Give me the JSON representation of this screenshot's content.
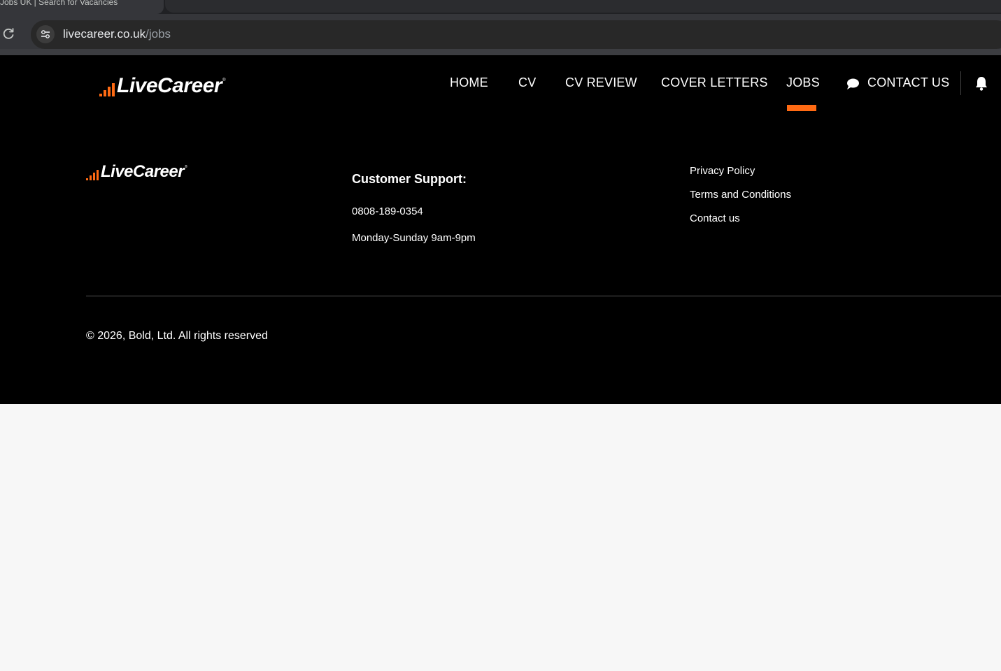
{
  "browser": {
    "tab_title": "Jobs UK | Search for Vacancies",
    "url_host": "livecareer.co.uk",
    "url_path": "/jobs"
  },
  "header": {
    "logo_text": "LiveCareer",
    "nav": [
      {
        "label": "HOME",
        "active": false
      },
      {
        "label": "CV",
        "active": false
      },
      {
        "label": "CV REVIEW",
        "active": false
      },
      {
        "label": "COVER LETTERS",
        "active": false
      },
      {
        "label": "JOBS",
        "active": true
      },
      {
        "label": "CONTACT US",
        "active": false
      }
    ]
  },
  "footer": {
    "logo_text": "LiveCareer",
    "support_heading": "Customer Support:",
    "phone": "0808-189-0354",
    "hours": "Monday-Sunday 9am-9pm",
    "links": [
      "Privacy Policy",
      "Terms and Conditions",
      "Contact us"
    ],
    "copyright": "© 2026, Bold, Ltd. All rights reserved"
  },
  "colors": {
    "brand_orange": "#ff6a13",
    "background": "#000000",
    "page_below": "#f7f7f7"
  },
  "icons": [
    "reload-icon",
    "site-info-icon",
    "logo-bars-icon",
    "chat-bubble-icon",
    "bell-icon"
  ]
}
